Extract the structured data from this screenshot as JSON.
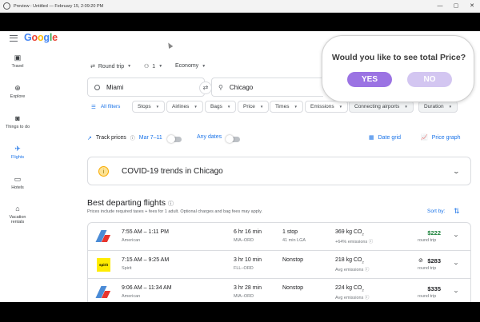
{
  "window": {
    "title": "Preview : Untitled — February 15, 2:09:20 PM",
    "minimize_icon": "minimize-icon",
    "maximize_icon": "maximize-icon",
    "close_icon": "close-icon",
    "minimize_glyph": "—",
    "maximize_glyph": "▢",
    "close_glyph": "✕"
  },
  "header": {
    "logo_letters": [
      "G",
      "o",
      "o",
      "g",
      "l",
      "e"
    ]
  },
  "sidebar": {
    "items": [
      {
        "label": "Travel",
        "icon": "luggage-icon",
        "glyph": "▣"
      },
      {
        "label": "Explore",
        "icon": "explore-icon",
        "glyph": "⊕"
      },
      {
        "label": "Things to do",
        "icon": "camera-icon",
        "glyph": "◙"
      },
      {
        "label": "Flights",
        "icon": "airplane-icon",
        "glyph": "✈",
        "active": true
      },
      {
        "label": "Hotels",
        "icon": "bed-icon",
        "glyph": "▭"
      },
      {
        "label": "Vacation",
        "label2": "rentals",
        "icon": "house-icon",
        "glyph": "⌂"
      }
    ]
  },
  "search": {
    "trip_type": "Round trip",
    "passengers": "1",
    "cabin": "Economy",
    "origin": "Miami",
    "destination": "Chicago"
  },
  "filters": {
    "all_filters": "All filters",
    "chips": [
      "Stops",
      "Airlines",
      "Bags",
      "Price",
      "Times",
      "Emissions",
      "Connecting airports",
      "Duration"
    ]
  },
  "track": {
    "label": "Track prices",
    "dates": "Mar 7–11",
    "any_dates": "Any dates",
    "date_grid": "Date grid",
    "price_graph": "Price graph"
  },
  "covid": {
    "text": "COVID-19 trends in Chicago"
  },
  "results": {
    "title": "Best departing flights",
    "subtitle": "Prices include required taxes + fees for 1 adult. Optional charges and bag fees may apply.",
    "sort_label": "Sort by:",
    "flights": [
      {
        "times": "7:55 AM – 1:11 PM",
        "airline": "American",
        "duration": "6 hr 16 min",
        "route": "MIA–ORD",
        "stops": "1 stop",
        "layover": "41 min LGA",
        "emissions": "369 kg CO",
        "emissions_note": "+64% emissions",
        "price": "$222",
        "price_type": "round trip",
        "logo": "american"
      },
      {
        "times": "7:15 AM – 9:25 AM",
        "airline": "Spirit",
        "duration": "3 hr 10 min",
        "route": "FLL–ORD",
        "stops": "Nonstop",
        "layover": "",
        "emissions": "218 kg CO",
        "emissions_note": "Avg emissions",
        "price": "$283",
        "price_type": "round trip",
        "logo": "spirit"
      },
      {
        "times": "9:06 AM – 11:34 AM",
        "airline": "American",
        "duration": "3 hr 28 min",
        "route": "MIA–ORD",
        "stops": "Nonstop",
        "layover": "",
        "emissions": "224 kg CO",
        "emissions_note": "Avg emissions",
        "price": "$335",
        "price_type": "round trip",
        "logo": "american"
      }
    ]
  },
  "popup": {
    "question": "Would you like to see total Price?",
    "yes_label": "YES",
    "no_label": "NO"
  },
  "colors": {
    "accent": "#1a73e8",
    "popup_yes": "#9b73e3",
    "popup_no": "#d3c6f1",
    "price_green": "#188038"
  }
}
